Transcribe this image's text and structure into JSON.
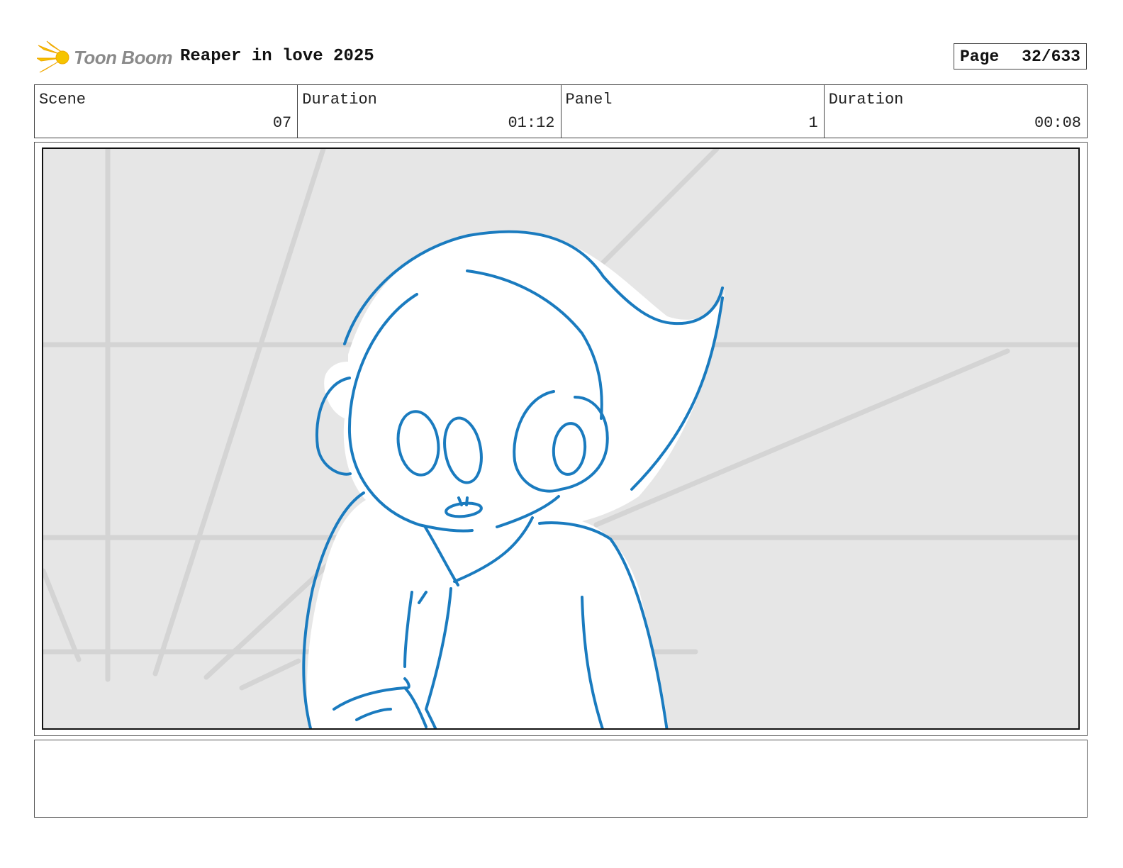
{
  "header": {
    "logo_text": "Toon Boom",
    "project_title": "Reaper in love 2025",
    "page_label": "Page",
    "page_value": "32/633"
  },
  "info": {
    "scene_label": "Scene",
    "scene_value": "07",
    "scene_duration_label": "Duration",
    "scene_duration_value": "01:12",
    "panel_label": "Panel",
    "panel_value": "1",
    "panel_duration_label": "Duration",
    "panel_duration_value": "00:08"
  },
  "colors": {
    "sketch_line": "#1a7bbf",
    "background_fill": "#e6e6e6",
    "guide_lines": "#d4d4d4",
    "logo_yellow": "#f5c400"
  },
  "notes": ""
}
